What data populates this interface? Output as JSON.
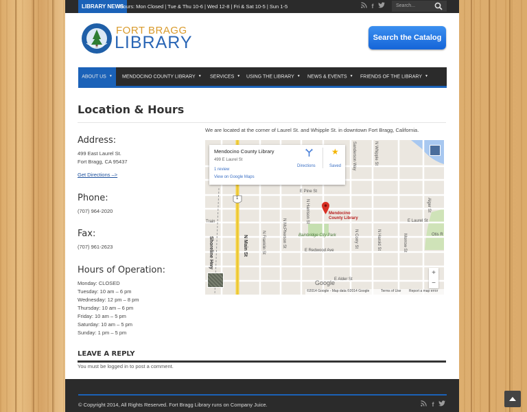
{
  "topbar": {
    "badge": "LIBRARY NEWS",
    "ticker": "Hours: Mon Closed | Tue & Thu 10-6 | Wed 12-8 | Fri & Sat 10-5 | Sun 1-5",
    "search_placeholder": "Search..."
  },
  "header": {
    "logo_top": "FORT BRAGG",
    "logo_bottom": "LIBRARY",
    "catalog_button": "Search the Catalog"
  },
  "nav": {
    "items": [
      {
        "label": "ABOUT US"
      },
      {
        "label": "MENDOCINO COUNTY LIBRARY"
      },
      {
        "label": "SERVICES"
      },
      {
        "label": "USING THE LIBRARY"
      },
      {
        "label": "NEWS & EVENTS"
      },
      {
        "label": "FRIENDS OF THE LIBRARY"
      }
    ]
  },
  "page": {
    "title": "Location & Hours"
  },
  "address": {
    "heading": "Address:",
    "line1": "499 East Laurel St.",
    "line2": "Fort Bragg, CA 95437",
    "directions": "Get Directions –>"
  },
  "phone": {
    "heading": "Phone:",
    "number": "(707) 964-2020"
  },
  "fax": {
    "heading": "Fax:",
    "number": "(707) 961-2623"
  },
  "hours": {
    "heading": "Hours of Operation:",
    "days": [
      "Monday: CLOSED",
      "Tuesday: 10 am – 6 pm",
      "Wednesday: 12 pm – 8 pm",
      "Thursday: 10 am – 6 pm",
      "Friday: 10 am – 5 pm",
      "Saturday: 10 am – 5 pm",
      "Sunday: 1 pm – 5 pm"
    ]
  },
  "map": {
    "intro": "We are located at the corner of Laurel St. and Whipple St. in downtown Fort Bragg, California.",
    "popup_title": "Mendocino County Library",
    "popup_address": "499 E Laurel St",
    "popup_reviews": "1 review",
    "popup_link": "View on Google Maps",
    "directions": "Directions",
    "saved": "Saved",
    "marker_label": "Mendocino County Library",
    "park": "Bainbridge City Park",
    "streets": [
      "E Pine St",
      "E Laurel St",
      "E Redwood Ave",
      "E Alder St",
      "Shoreline Hwy",
      "N Main St",
      "N McPherson St",
      "N Harrison St",
      "N Franklin St",
      "N Corry St",
      "N Harold St",
      "Morrow St",
      "Alger St",
      "Sanderson Way",
      "N Whipple St",
      "Otis R",
      "Train"
    ],
    "route_shield": "1",
    "google": "Google",
    "attribution": "©2014 Google - Map data ©2014 Google",
    "terms": "Terms of Use",
    "report": "Report a map error",
    "zoom_in": "+",
    "zoom_out": "−"
  },
  "comments": {
    "heading": "LEAVE A REPLY",
    "note": "You must be logged in to post a comment."
  },
  "footer": {
    "copyright": "© Copyright 2014, All Rights Reserved. Fort Bragg Library runs on Company Juice."
  },
  "colors": {
    "accent": "#1b62b8",
    "dark": "#2b2b2b",
    "logo_orange": "#d99a2b",
    "marker": "#d93025"
  }
}
